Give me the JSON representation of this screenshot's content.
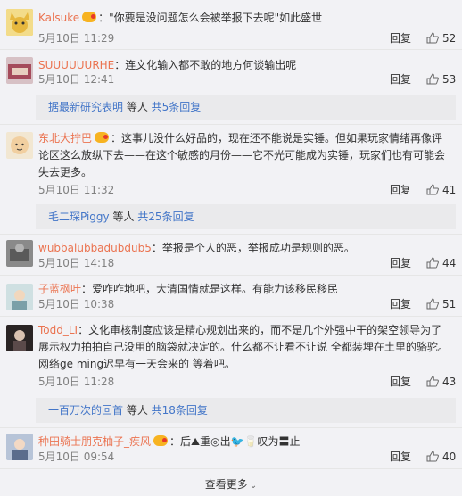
{
  "comments": [
    {
      "name": "Kalsuke",
      "text": "：\"你要是没问题怎么会被举报下去呢\"如此盛世",
      "time": "5月10日 11:29",
      "reply": "回复",
      "likes": "52",
      "avatar_color": "#e7c24a"
    },
    {
      "name": "SUUUUUURHE",
      "text": "：连文化输入都不敢的地方何谈输出呢",
      "time": "5月10日 12:41",
      "reply": "回复",
      "likes": "53",
      "avatar_color": "#b96070"
    },
    {
      "name": "东北大拧巴",
      "text": "：这事儿没什么好品的，现在还不能说是实锤。但如果玩家情绪再像评论区这么放纵下去——在这个敏感的月份——它不光可能成为实锤，玩家们也有可能会失去更多。",
      "time": "5月10日 11:32",
      "reply": "回复",
      "likes": "41",
      "avatar_color": "#c9a372"
    },
    {
      "name": "wubbalubbadubdub5",
      "text": "：举报是个人的恶，举报成功是规则的恶。",
      "time": "5月10日 14:18",
      "reply": "回复",
      "likes": "44",
      "avatar_color": "#6b6b6b"
    },
    {
      "name": "子蓝枫叶",
      "text": "：爱咋咋地吧，大清国情就是这样。有能力该移民移民",
      "time": "5月10日 10:38",
      "reply": "回复",
      "likes": "51",
      "avatar_color": "#8fb0b6"
    },
    {
      "name": "Todd_LI",
      "text": "：文化审核制度应该是精心规划出来的，而不是几个外强中干的架空领导为了展示权力拍拍自己没用的脑袋就决定的。什么都不让看不让说 全都装埋在土里的骆驼。网络ge ming迟早有一天会来的 等着吧。",
      "time": "5月10日 11:28",
      "reply": "回复",
      "likes": "43",
      "avatar_color": "#3a3030"
    },
    {
      "name": "种田骑士朋克柚子_疾风",
      "text": "：后⛰重◎出🐦🥛叹为〓止",
      "time": "5月10日 09:54",
      "reply": "回复",
      "likes": "40",
      "avatar_color": "#6c7fa0"
    }
  ],
  "subreplies": [
    {
      "name": "据最新研究表明",
      "mid": " 等人 ",
      "count": "共5条回复"
    },
    {
      "name": "毛二琛Piggy",
      "mid": " 等人 ",
      "count": "共25条回复"
    },
    {
      "name": "一百万次的回首",
      "mid": " 等人 ",
      "count": "共18条回复"
    }
  ],
  "footer": {
    "more_label": "查看更多",
    "chevron": "⌄"
  }
}
